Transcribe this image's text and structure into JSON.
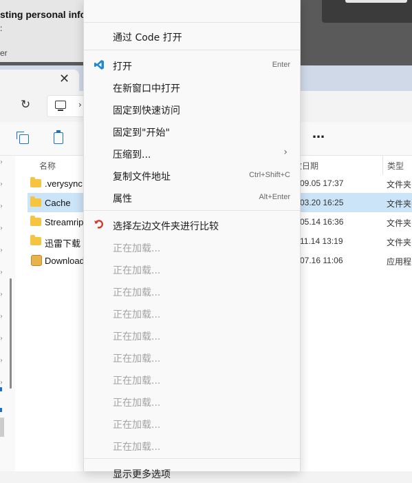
{
  "background": {
    "text_line1": "sting personal info",
    "text_line2": ":",
    "text_line3": "er"
  },
  "explorer": {
    "tab_close_glyph": "✕",
    "toolbar_more_glyph": "…",
    "columns": {
      "name": "名称",
      "date": "改日期",
      "type": "类型"
    },
    "files": [
      {
        "name": ".verysync",
        "date": "09.05 17:37",
        "type": "文件夹",
        "icon": "folder-icon",
        "selected": false
      },
      {
        "name": "Cache",
        "date": "03.20 16:25",
        "type": "文件夹",
        "icon": "folder-icon",
        "selected": true
      },
      {
        "name": "Streamrip",
        "date": "05.14 16:36",
        "type": "文件夹",
        "icon": "folder-icon",
        "selected": false
      },
      {
        "name": "迅雷下载",
        "date": "11.14 13:19",
        "type": "文件夹",
        "icon": "folder-icon",
        "selected": false
      },
      {
        "name": "Download",
        "date": "07.16 11:06",
        "type": "应用程",
        "icon": "app-icon",
        "selected": false
      }
    ]
  },
  "menu": {
    "open_with_code": "通过 Code 打开",
    "items": [
      {
        "label": "打开",
        "shortcut": "Enter",
        "icon": "vscode-icon"
      },
      {
        "label": "在新窗口中打开",
        "shortcut": ""
      },
      {
        "label": "固定到快速访问",
        "shortcut": ""
      },
      {
        "label": "固定到\"开始\"",
        "shortcut": ""
      },
      {
        "label": "压缩到...",
        "shortcut": "",
        "submenu": true
      },
      {
        "label": "复制文件地址",
        "shortcut": "Ctrl+Shift+C"
      },
      {
        "label": "属性",
        "shortcut": "Alt+Enter"
      }
    ],
    "compare_label": "选择左边文件夹进行比较",
    "loading_label": "正在加载...",
    "loading_count": 10,
    "show_more": "显示更多选项"
  },
  "colors": {
    "accent": "#1a6fc9",
    "selection": "#cce4f7",
    "disabled_text": "#a3a3a3"
  }
}
